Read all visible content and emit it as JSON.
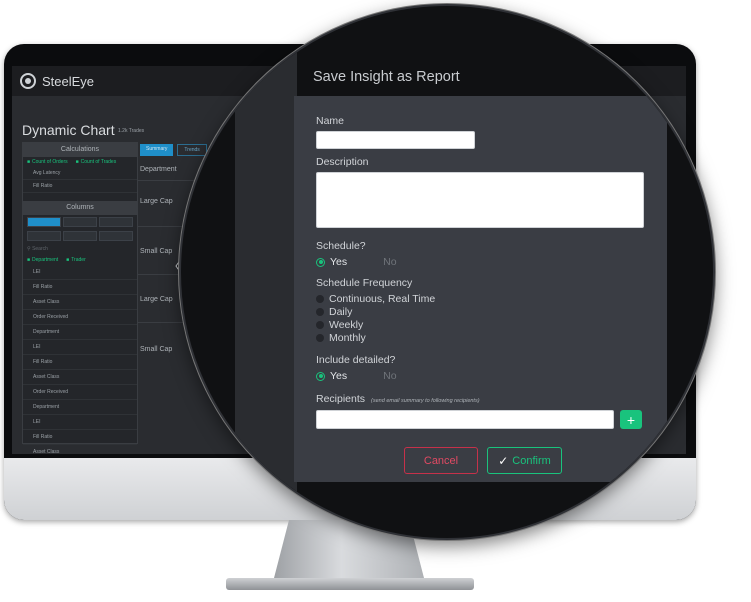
{
  "app": {
    "brand": "SteelEye",
    "page_title": "Dynamic Chart",
    "page_subtitle": "1.2k Trades"
  },
  "sidebar": {
    "calculations_header": "Calculations",
    "calc_checks": [
      "Count of Orders",
      "Count of Trades"
    ],
    "calc_items": [
      "Avg Latency",
      "Fill Ratio"
    ],
    "columns_header": "Columns",
    "search_placeholder": "Search",
    "column_checks": [
      "Department",
      "Trader"
    ],
    "column_items": [
      "LEI",
      "Fill Ratio",
      "Asset Class",
      "Order Received",
      "Department",
      "LEI",
      "Fill Ratio",
      "Asset Class",
      "Order Received",
      "Department",
      "LEI",
      "Fill Ratio",
      "Asset Class"
    ]
  },
  "chart_tabs": [
    "Summary",
    "Trends"
  ],
  "table": {
    "column_header": "Department",
    "rows": [
      "Large Cap",
      "Small Cap",
      "Large Cap",
      "Small Cap"
    ]
  },
  "modal": {
    "title": "Save Insight as Report",
    "name_label": "Name",
    "name_value": "",
    "description_label": "Description",
    "description_value": "",
    "schedule_label": "Schedule?",
    "schedule_yes": "Yes",
    "schedule_no": "No",
    "frequency_label": "Schedule Frequency",
    "frequency_options": [
      "Continuous, Real Time",
      "Daily",
      "Weekly",
      "Monthly"
    ],
    "detailed_label": "Include detailed?",
    "detailed_yes": "Yes",
    "detailed_no": "No",
    "recipients_label": "Recipients",
    "recipients_hint": "(send email summary to following recipients)",
    "recipients_value": "",
    "add_icon": "+",
    "cancel_label": "Cancel",
    "confirm_label": "Confirm",
    "confirm_icon": "✓"
  },
  "colors": {
    "accent_green": "#19c37d",
    "cancel_red": "#c6314a",
    "modal_bg": "#3a3d44"
  }
}
